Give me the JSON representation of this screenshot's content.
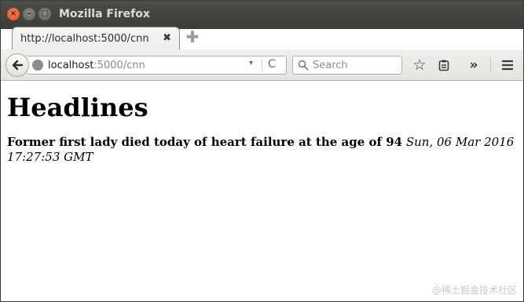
{
  "window": {
    "title": "Mozilla Firefox",
    "close_glyph": "×",
    "minimize_glyph": "–",
    "maximize_glyph": "□"
  },
  "tabs": [
    {
      "label": "http://localhost:5000/cnn",
      "close_glyph": "✖",
      "active": true
    }
  ],
  "new_tab_glyph": "✚",
  "navbar": {
    "url_host": "localhost",
    "url_path": ":5000/cnn",
    "dropdown_glyph": "▾",
    "reload_glyph": "C",
    "search_placeholder": "Search",
    "star_glyph": "☆",
    "overflow_glyph": "»"
  },
  "page": {
    "heading": "Headlines",
    "stories": [
      {
        "title": "Former first lady died today of heart failure at the age of 94",
        "date": "Sun, 06 Mar 2016 17:27:53 GMT"
      }
    ]
  },
  "watermark": "@稀土掘金技术社区",
  "icons": [
    "back-arrow-icon",
    "globe-icon",
    "search-icon",
    "bookmark-star-icon",
    "reading-list-icon",
    "menu-icon"
  ],
  "colors": {
    "titlebar": "#3c3c39",
    "close_button": "#df4a16",
    "navbar": "#e6e4e1"
  }
}
